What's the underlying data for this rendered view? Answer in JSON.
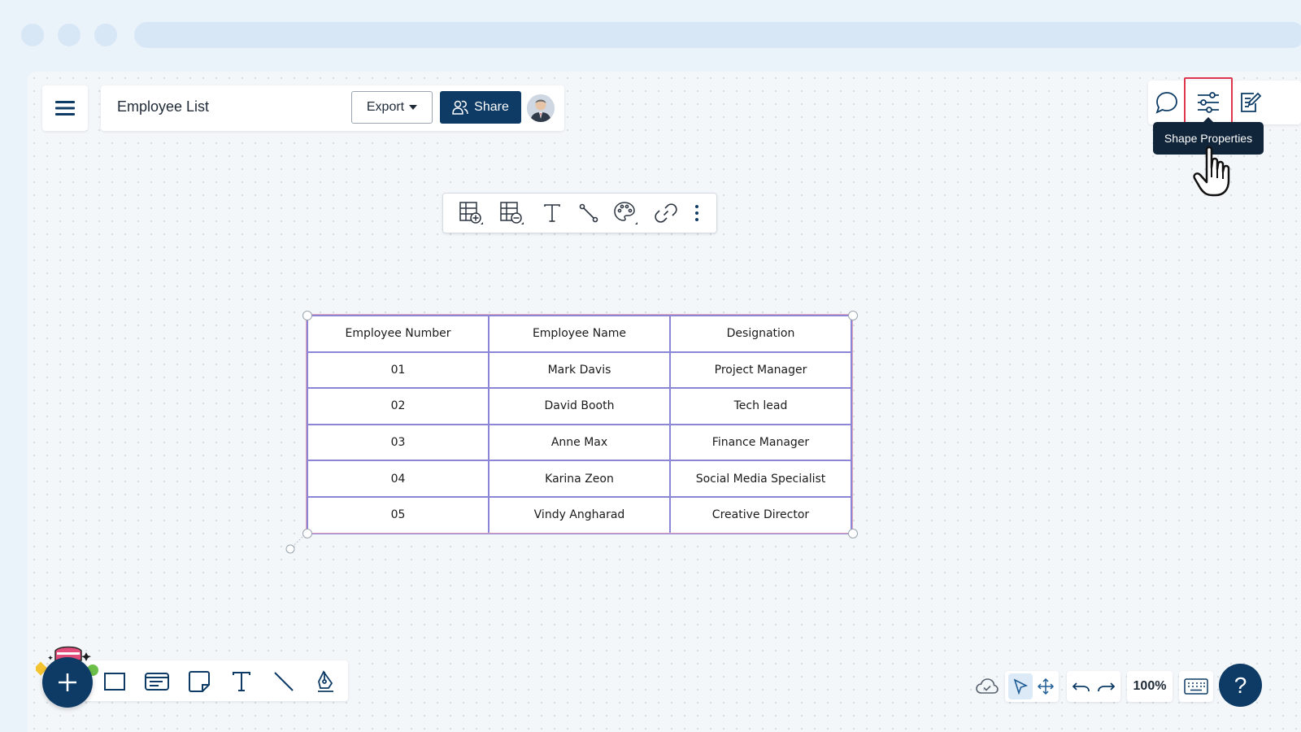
{
  "document": {
    "title": "Employee List"
  },
  "header": {
    "export_label": "Export",
    "share_label": "Share"
  },
  "right_panel": {
    "tooltip": "Shape Properties"
  },
  "table": {
    "headers": [
      "Employee Number",
      "Employee Name",
      "Designation"
    ],
    "rows": [
      [
        "01",
        "Mark Davis",
        "Project Manager"
      ],
      [
        "02",
        "David Booth",
        "Tech lead"
      ],
      [
        "03",
        "Anne Max",
        "Finance Manager"
      ],
      [
        "04",
        "Karina Zeon",
        "Social Media Specialist"
      ],
      [
        "05",
        "Vindy Angharad",
        "Creative Director"
      ]
    ]
  },
  "status": {
    "zoom": "100%",
    "help": "?"
  },
  "colors": {
    "primary": "#0d3b66",
    "table_border": "#8c86d8",
    "highlight": "#e0364d"
  }
}
